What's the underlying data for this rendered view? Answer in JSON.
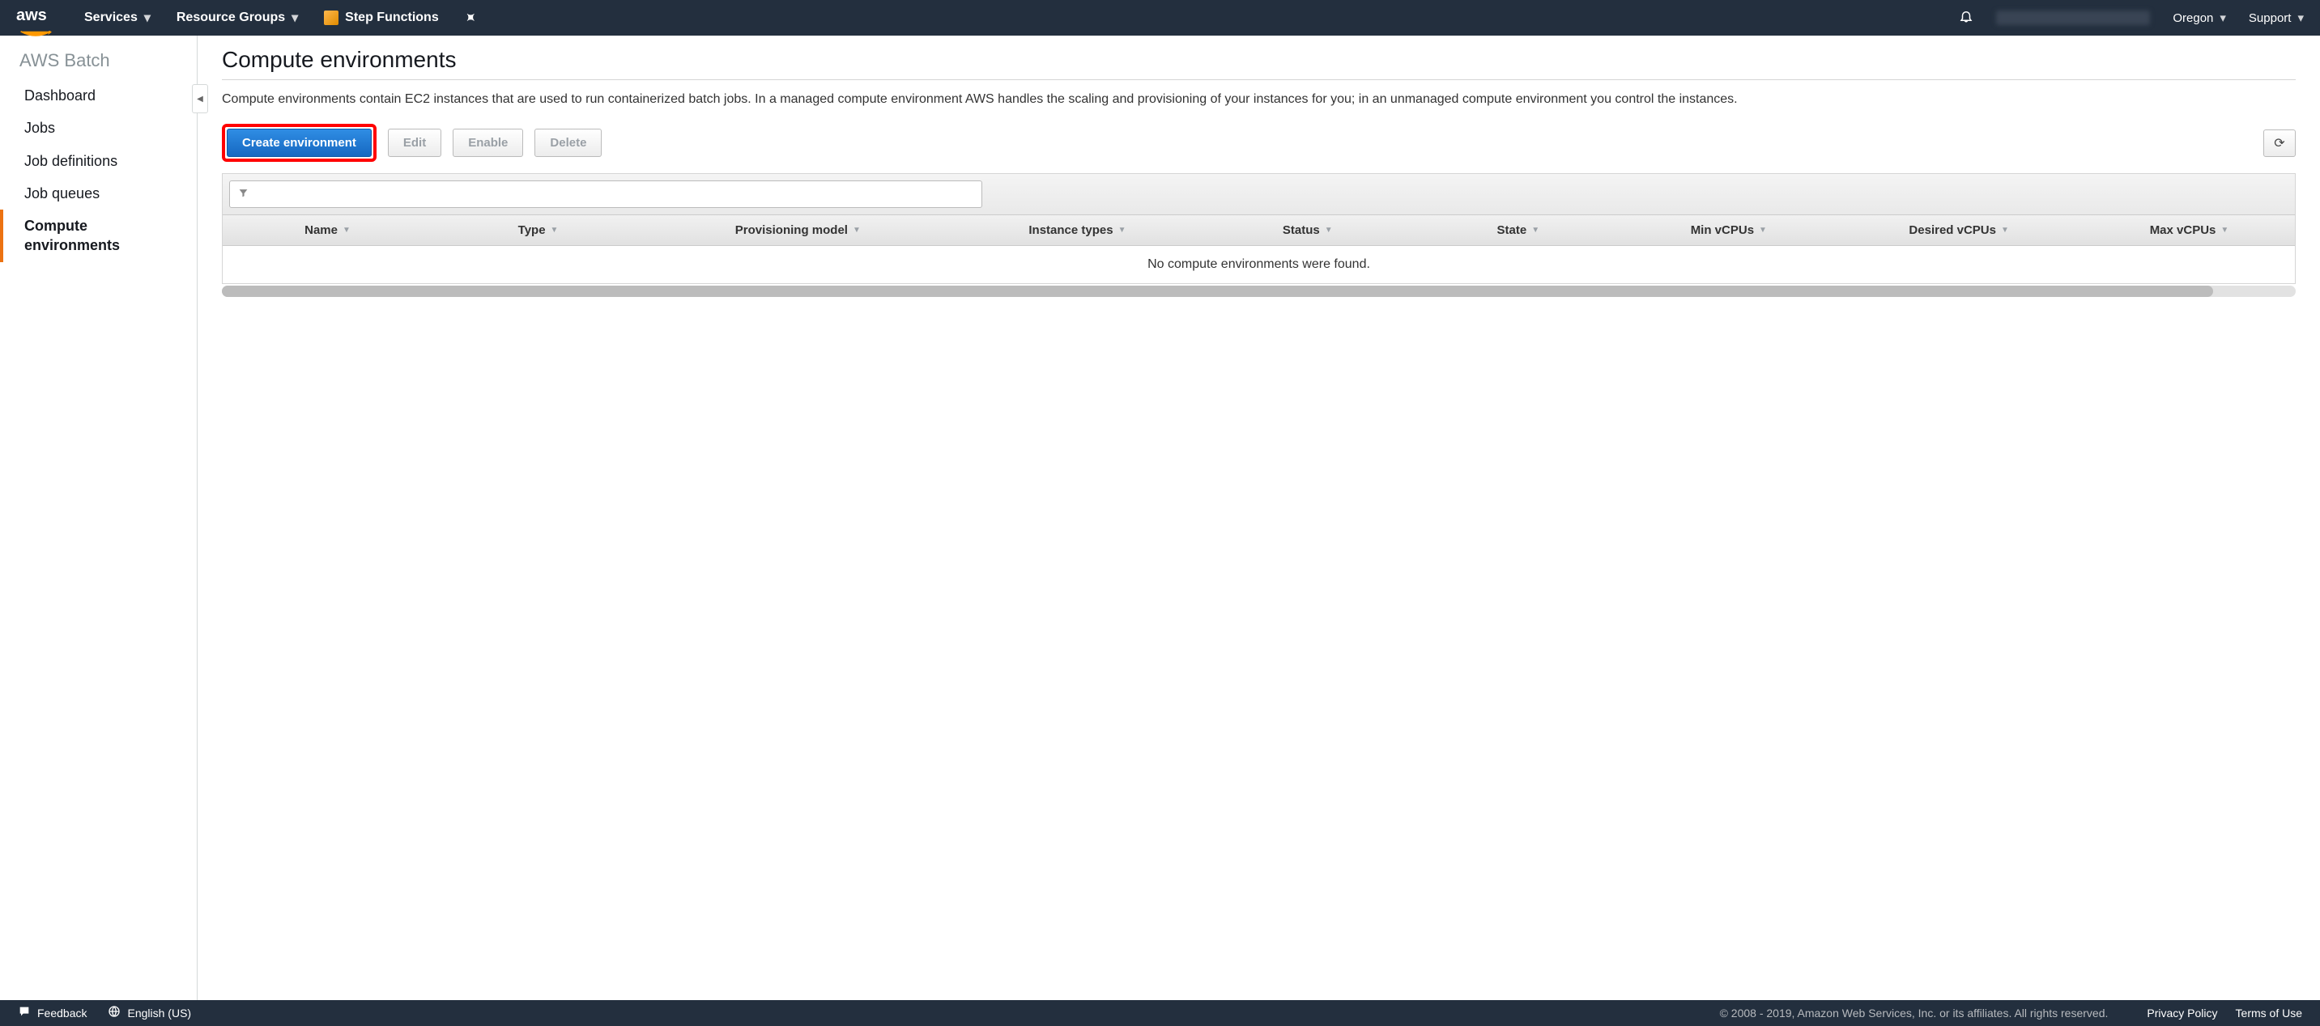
{
  "topnav": {
    "logo_text": "aws",
    "services": "Services",
    "resource_groups": "Resource Groups",
    "step_functions": "Step Functions",
    "region": "Oregon",
    "support": "Support"
  },
  "sidebar": {
    "service_title": "AWS Batch",
    "items": [
      {
        "label": "Dashboard",
        "active": false
      },
      {
        "label": "Jobs",
        "active": false
      },
      {
        "label": "Job definitions",
        "active": false
      },
      {
        "label": "Job queues",
        "active": false
      },
      {
        "label": "Compute environments",
        "active": true
      }
    ]
  },
  "page": {
    "title": "Compute environments",
    "description": "Compute environments contain EC2 instances that are used to run containerized batch jobs. In a managed compute environment AWS handles the scaling and provisioning of your instances for you; in an unmanaged compute environment you control the instances."
  },
  "actions": {
    "create": "Create environment",
    "edit": "Edit",
    "enable": "Enable",
    "delete": "Delete"
  },
  "table": {
    "columns": [
      "Name",
      "Type",
      "Provisioning model",
      "Instance types",
      "Status",
      "State",
      "Min vCPUs",
      "Desired vCPUs",
      "Max vCPUs"
    ],
    "empty_text": "No compute environments were found."
  },
  "footer": {
    "feedback": "Feedback",
    "language": "English (US)",
    "copyright": "© 2008 - 2019, Amazon Web Services, Inc. or its affiliates. All rights reserved.",
    "privacy": "Privacy Policy",
    "terms": "Terms of Use"
  }
}
